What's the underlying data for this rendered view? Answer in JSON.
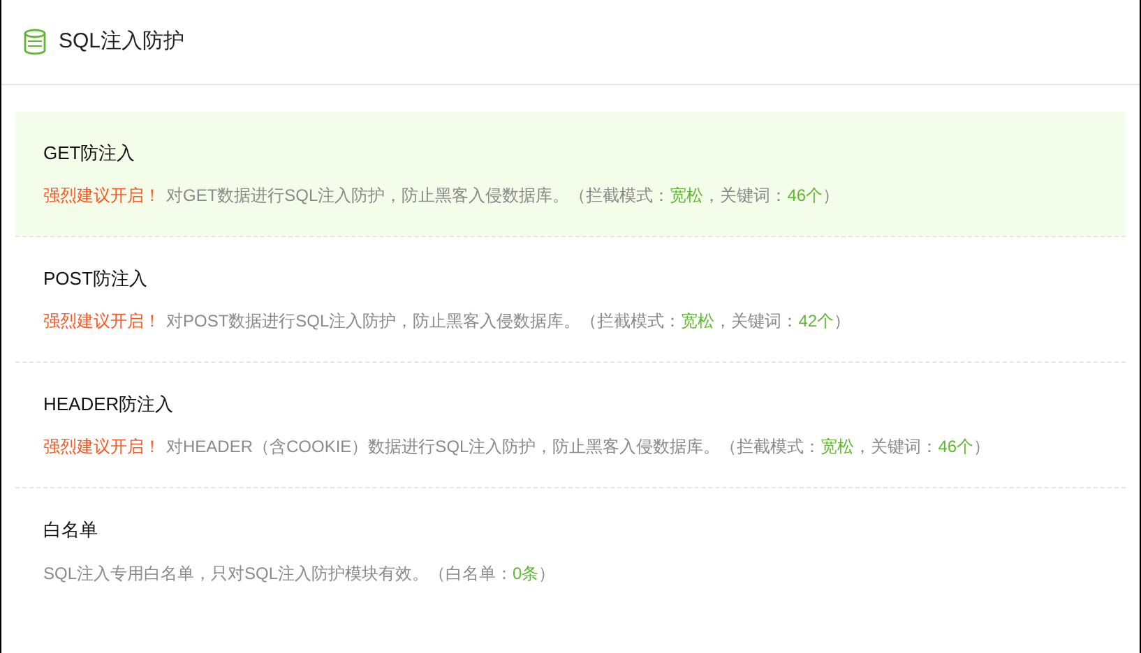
{
  "header": {
    "title": "SQL注入防护"
  },
  "items": [
    {
      "title": "GET防注入",
      "selected": true,
      "description": [
        {
          "kind": "warning",
          "text": "强烈建议开启！"
        },
        {
          "kind": "text",
          "text": "对GET数据进行SQL注入防护，防止黑客入侵数据库。（拦截模式："
        },
        {
          "kind": "value",
          "text": "宽松"
        },
        {
          "kind": "text",
          "text": "，关键词："
        },
        {
          "kind": "value",
          "text": "46个"
        },
        {
          "kind": "text",
          "text": "）"
        }
      ]
    },
    {
      "title": "POST防注入",
      "selected": false,
      "description": [
        {
          "kind": "warning",
          "text": "强烈建议开启！"
        },
        {
          "kind": "text",
          "text": "对POST数据进行SQL注入防护，防止黑客入侵数据库。（拦截模式："
        },
        {
          "kind": "value",
          "text": "宽松"
        },
        {
          "kind": "text",
          "text": "，关键词："
        },
        {
          "kind": "value",
          "text": "42个"
        },
        {
          "kind": "text",
          "text": "）"
        }
      ]
    },
    {
      "title": "HEADER防注入",
      "selected": false,
      "description": [
        {
          "kind": "warning",
          "text": "强烈建议开启！"
        },
        {
          "kind": "text",
          "text": "对HEADER（含COOKIE）数据进行SQL注入防护，防止黑客入侵数据库。（拦截模式："
        },
        {
          "kind": "value",
          "text": "宽松"
        },
        {
          "kind": "text",
          "text": "，关键词："
        },
        {
          "kind": "value",
          "text": "46个"
        },
        {
          "kind": "text",
          "text": "）"
        }
      ]
    },
    {
      "title": "白名单",
      "selected": false,
      "description": [
        {
          "kind": "text",
          "text": "SQL注入专用白名单，只对SQL注入防护模块有效。（白名单："
        },
        {
          "kind": "value",
          "text": "0条"
        },
        {
          "kind": "text",
          "text": "）"
        }
      ]
    }
  ]
}
